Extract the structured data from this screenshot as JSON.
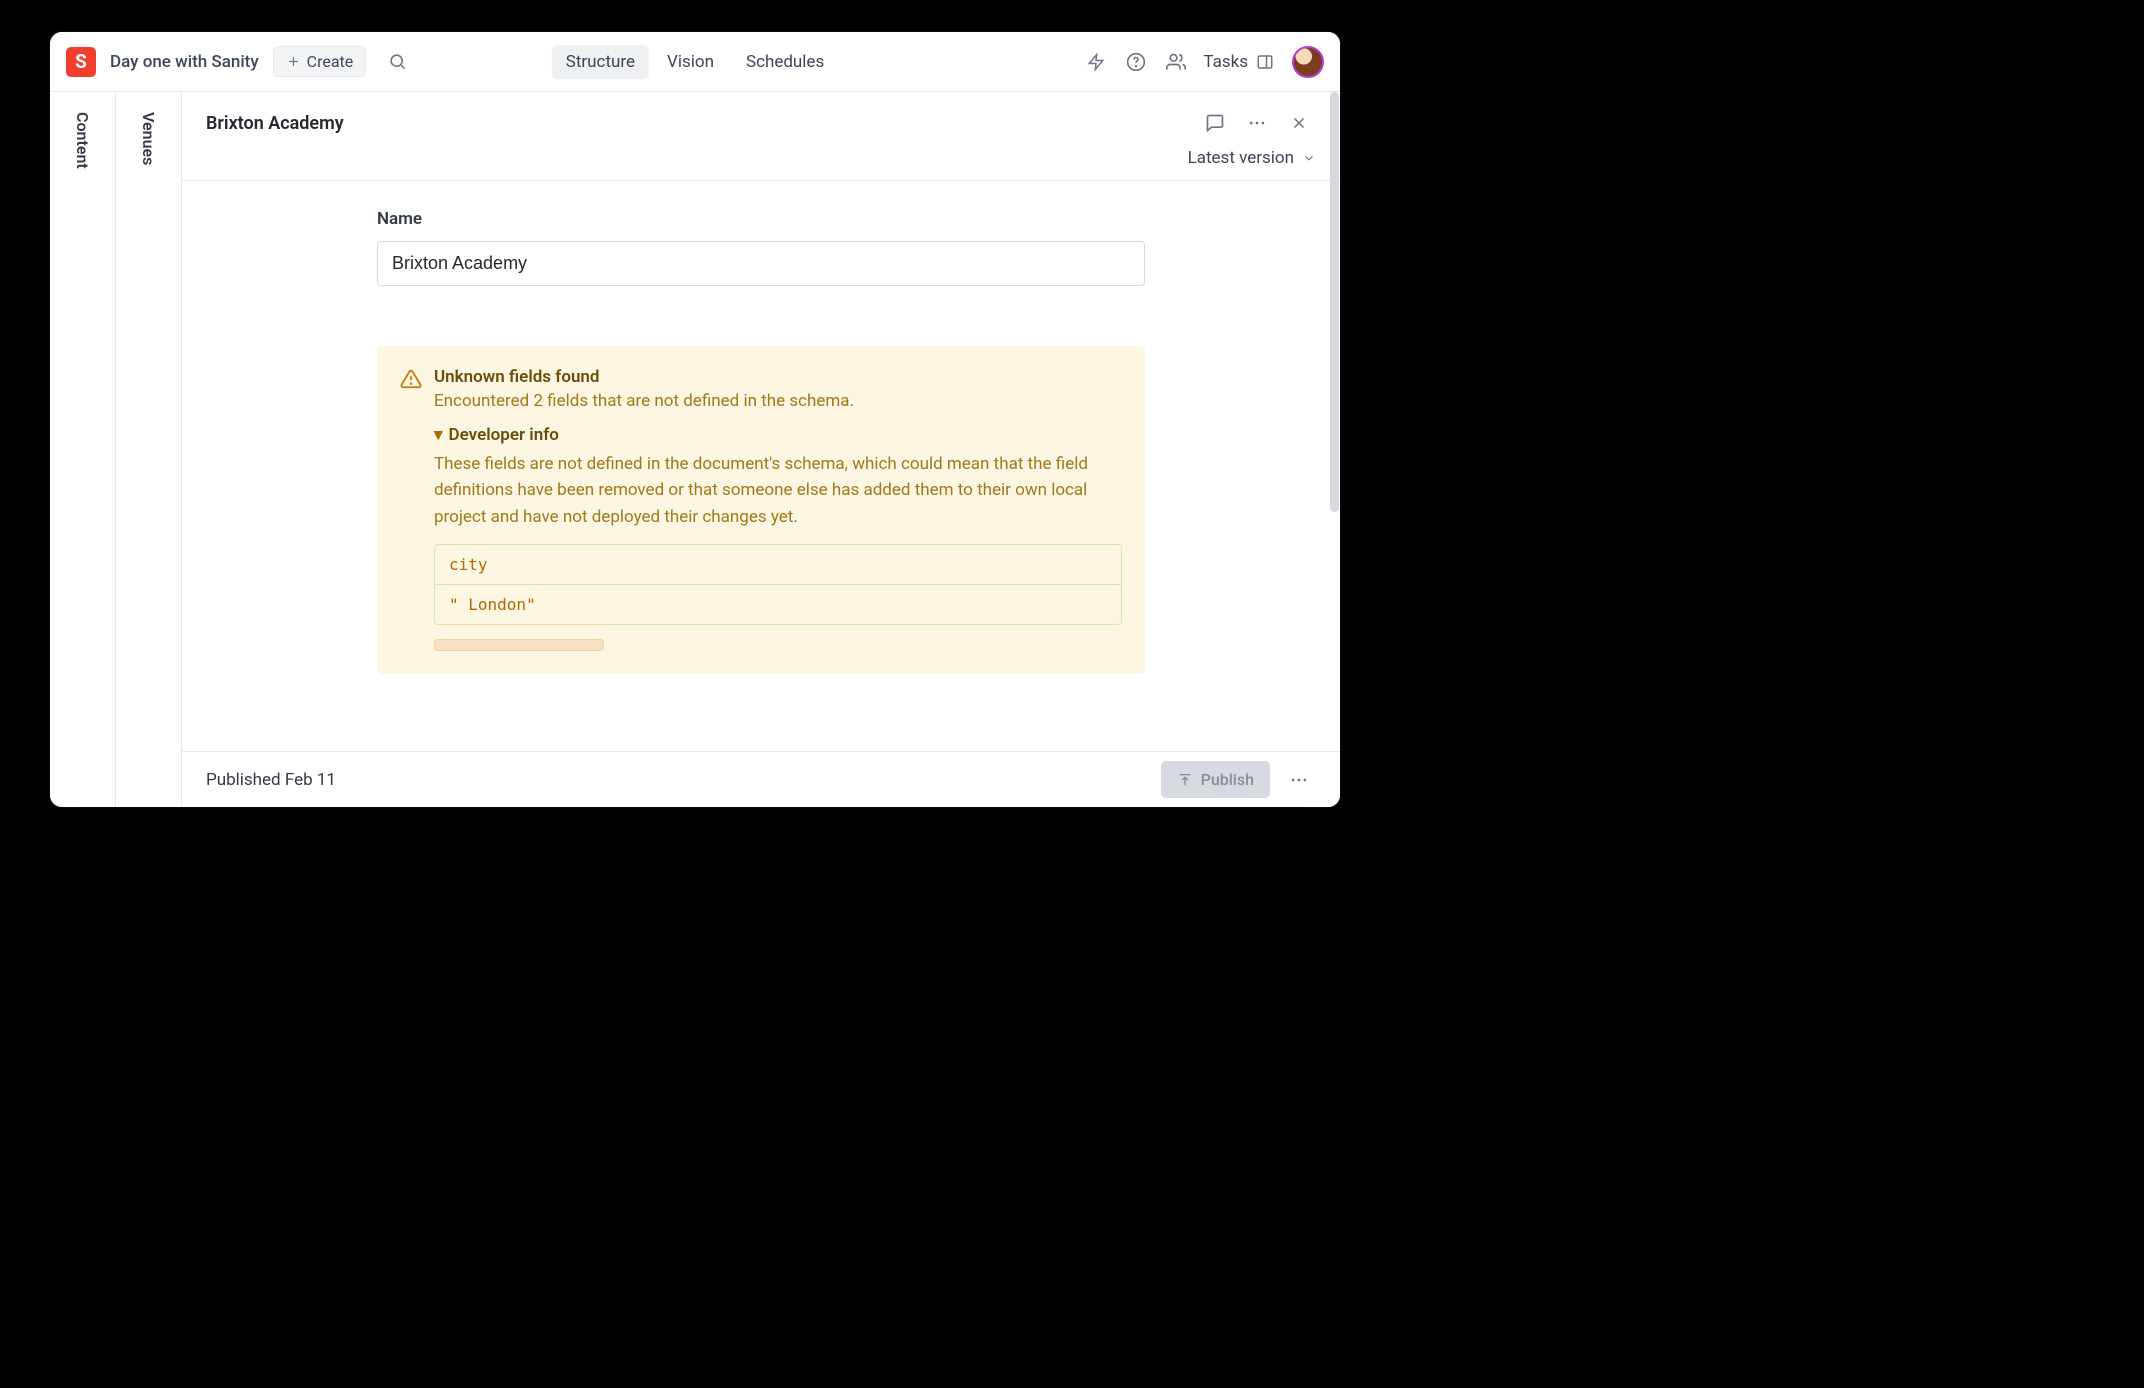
{
  "topbar": {
    "logo_letter": "S",
    "project_title": "Day one with Sanity",
    "create_label": "Create",
    "tabs": [
      "Structure",
      "Vision",
      "Schedules"
    ],
    "active_tab": 0,
    "tasks_label": "Tasks"
  },
  "rails": {
    "content_label": "Content",
    "venues_label": "Venues"
  },
  "document": {
    "title": "Brixton Academy",
    "version_label": "Latest version",
    "fields": {
      "name_label": "Name",
      "name_value": "Brixton Academy"
    }
  },
  "warning": {
    "title": "Unknown fields found",
    "subtitle": "Encountered 2 fields that are not defined in the schema.",
    "dev_toggle": "Developer info",
    "dev_desc": "These fields are not defined in the document's schema, which could mean that the field definitions have been removed or that someone else has added them to their own local project and have not deployed their changes yet.",
    "rows": [
      "city",
      "\" London\""
    ]
  },
  "footer": {
    "status": "Published Feb 11",
    "publish_label": "Publish"
  }
}
